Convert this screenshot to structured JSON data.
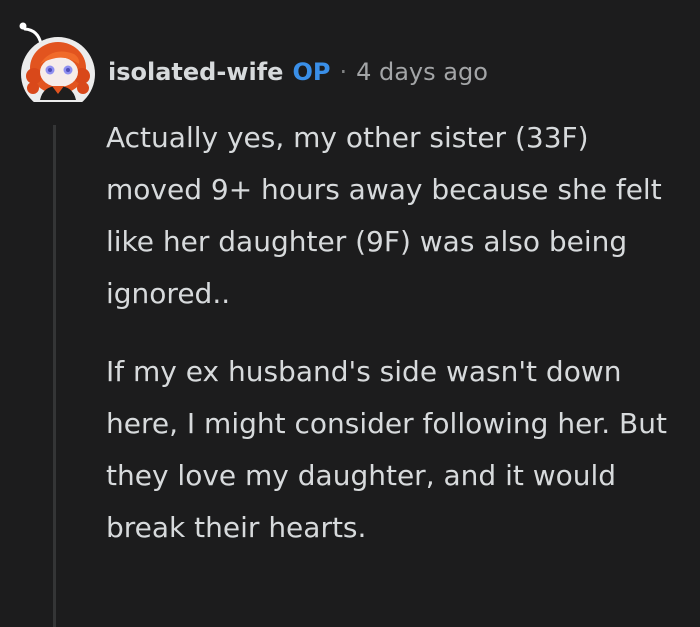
{
  "comment": {
    "author": "isolated-wife",
    "op_label": "OP",
    "separator": "·",
    "timestamp": "4 days ago",
    "paragraphs": [
      "Actually yes, my other sister (33F) moved 9+ hours away because she felt like her daughter (9F) was also being ignored..",
      "If my ex husband's side wasn't down here, I might consider following her. But they love my daughter, and it would break their hearts."
    ]
  },
  "colors": {
    "background": "#1c1c1d",
    "text": "#d7dadc",
    "op_badge": "#3a8fe8",
    "muted": "#a3a5a7",
    "thread_line": "#343536",
    "avatar_circle": "#ececec",
    "avatar_hair": "#e2541f"
  },
  "icons": {
    "avatar": "snoo-avatar-icon"
  }
}
